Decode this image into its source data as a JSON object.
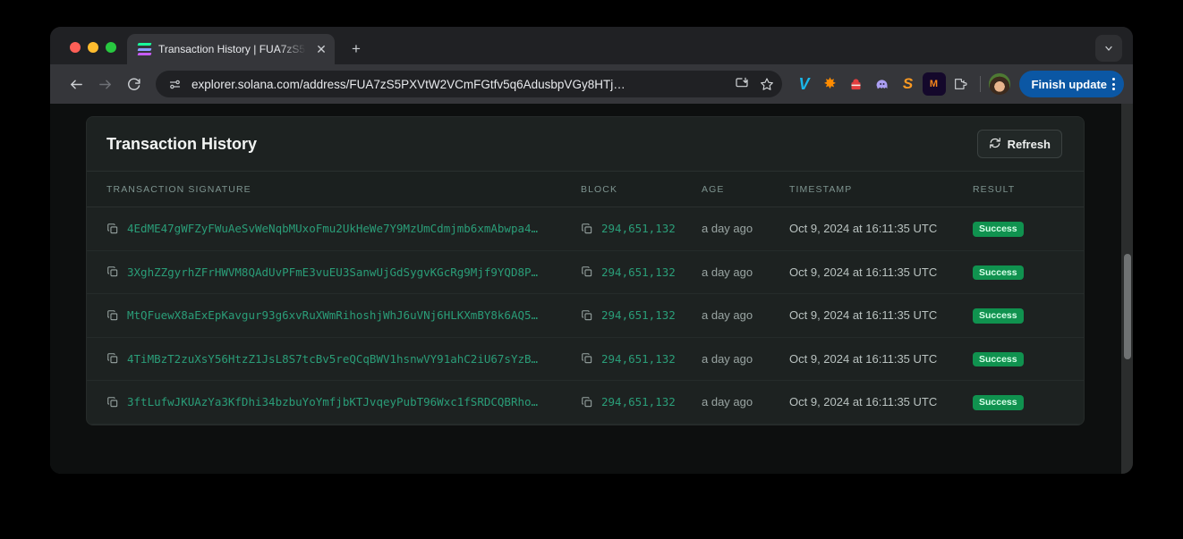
{
  "browser": {
    "tab": {
      "title": "Transaction History | FUA7zS5",
      "favicon": "solana-logo-icon",
      "close_label": "✕"
    },
    "new_tab_label": "+",
    "nav": {
      "back": "back-icon",
      "forward": "forward-icon",
      "reload": "reload-icon"
    },
    "omnibox": {
      "url": "explorer.solana.com/address/FUA7zS5PXVtW2VCmFGtfv5q6AdusbpVGy8HTj…",
      "site_settings_icon": "tune-icon",
      "install_icon": "install-app-icon",
      "bookmark_icon": "star-icon"
    },
    "extensions": [
      {
        "name": "vimeo-extension-icon",
        "glyph": "𝑽",
        "color": "#1ab7ea",
        "bg": "transparent"
      },
      {
        "name": "sparkle-extension-icon",
        "glyph": "✸",
        "color": "#ff8c00",
        "bg": "transparent"
      },
      {
        "name": "backpack-wallet-icon",
        "glyph": "▮",
        "color": "#e33e3f",
        "bg": "transparent"
      },
      {
        "name": "phantom-wallet-icon",
        "glyph": "●",
        "color": "#ab9ff2",
        "bg": "transparent"
      },
      {
        "name": "solflare-wallet-icon",
        "glyph": "S",
        "color": "#fc9a22",
        "bg": "transparent"
      },
      {
        "name": "metamask-extension-icon",
        "glyph": "M",
        "color": "#f6851b",
        "bg": "#14082b"
      },
      {
        "name": "extensions-puzzle-icon",
        "glyph": "⬚",
        "color": "#d2d5d8",
        "bg": "transparent"
      }
    ],
    "profile": {
      "name": "profile-avatar"
    },
    "update_button": {
      "label": "Finish update",
      "color": "#0b57a4"
    },
    "tab_list_chevron": "chevron-down-icon"
  },
  "page": {
    "title": "Transaction History",
    "refresh_label": "Refresh",
    "table": {
      "columns": [
        "TRANSACTION SIGNATURE",
        "BLOCK",
        "AGE",
        "TIMESTAMP",
        "RESULT"
      ],
      "rows": [
        {
          "signature": "4EdME47gWFZyFWuAeSvWeNqbMUxoFmu2UkHeWe7Y9MzUmCdmjmb6xmAbwpa4…",
          "block": "294,651,132",
          "age": "a day ago",
          "timestamp": "Oct 9, 2024 at 16:11:35 UTC",
          "result": "Success"
        },
        {
          "signature": "3XghZZgyrhZFrHWVM8QAdUvPFmE3vuEU3SanwUjGdSygvKGcRg9Mjf9YQD8P…",
          "block": "294,651,132",
          "age": "a day ago",
          "timestamp": "Oct 9, 2024 at 16:11:35 UTC",
          "result": "Success"
        },
        {
          "signature": "MtQFuewX8aExEpKavgur93g6xvRuXWmRihoshjWhJ6uVNj6HLKXmBY8k6AQ5…",
          "block": "294,651,132",
          "age": "a day ago",
          "timestamp": "Oct 9, 2024 at 16:11:35 UTC",
          "result": "Success"
        },
        {
          "signature": "4TiMBzT2zuXsY56HtzZ1JsL8S7tcBv5reQCqBWV1hsnwVY91ahC2iU67sYzB…",
          "block": "294,651,132",
          "age": "a day ago",
          "timestamp": "Oct 9, 2024 at 16:11:35 UTC",
          "result": "Success"
        },
        {
          "signature": "3ftLufwJKUAzYa3KfDhi34bzbuYoYmfjbKTJvqeyPubT96Wxc1fSRDCQBRho…",
          "block": "294,651,132",
          "age": "a day ago",
          "timestamp": "Oct 9, 2024 at 16:11:35 UTC",
          "result": "Success"
        }
      ]
    }
  },
  "colors": {
    "accent_green": "#2a9d78",
    "success_badge": "#10924f",
    "update_blue": "#0b57a4"
  }
}
